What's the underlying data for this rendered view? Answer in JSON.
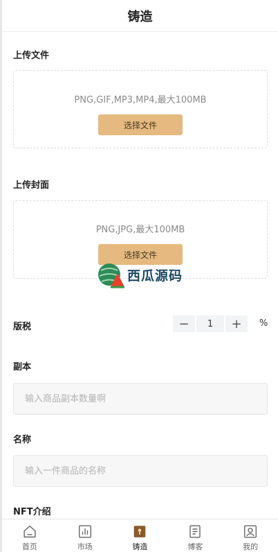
{
  "header": {
    "title": "铸造"
  },
  "upload_file": {
    "title": "上传文件",
    "hint": "PNG,GIF,MP3,MP4,最大100MB",
    "button": "选择文件"
  },
  "upload_cover": {
    "title": "上传封面",
    "hint": "PNG,JPG,最大100MB",
    "button": "选择文件"
  },
  "royalty": {
    "label": "版税",
    "minus": "−",
    "value": "1",
    "plus": "+",
    "unit": "%"
  },
  "copies": {
    "label": "副本",
    "placeholder": "输入商品副本数量啊"
  },
  "name": {
    "label": "名称",
    "placeholder": "输入一件商品的名称"
  },
  "intro": {
    "label": "NFT介绍"
  },
  "watermark": {
    "text": "西瓜源码"
  },
  "tabs": [
    {
      "label": "首页",
      "icon": "home-icon",
      "active": false
    },
    {
      "label": "市场",
      "icon": "market-chart-icon",
      "active": false
    },
    {
      "label": "铸造",
      "icon": "mint-icon",
      "active": true
    },
    {
      "label": "博客",
      "icon": "blog-document-icon",
      "active": false
    },
    {
      "label": "我的",
      "icon": "profile-icon",
      "active": false
    }
  ],
  "colors": {
    "accent": "#e5b97f",
    "active_tab_icon": "#8b5a2b"
  }
}
